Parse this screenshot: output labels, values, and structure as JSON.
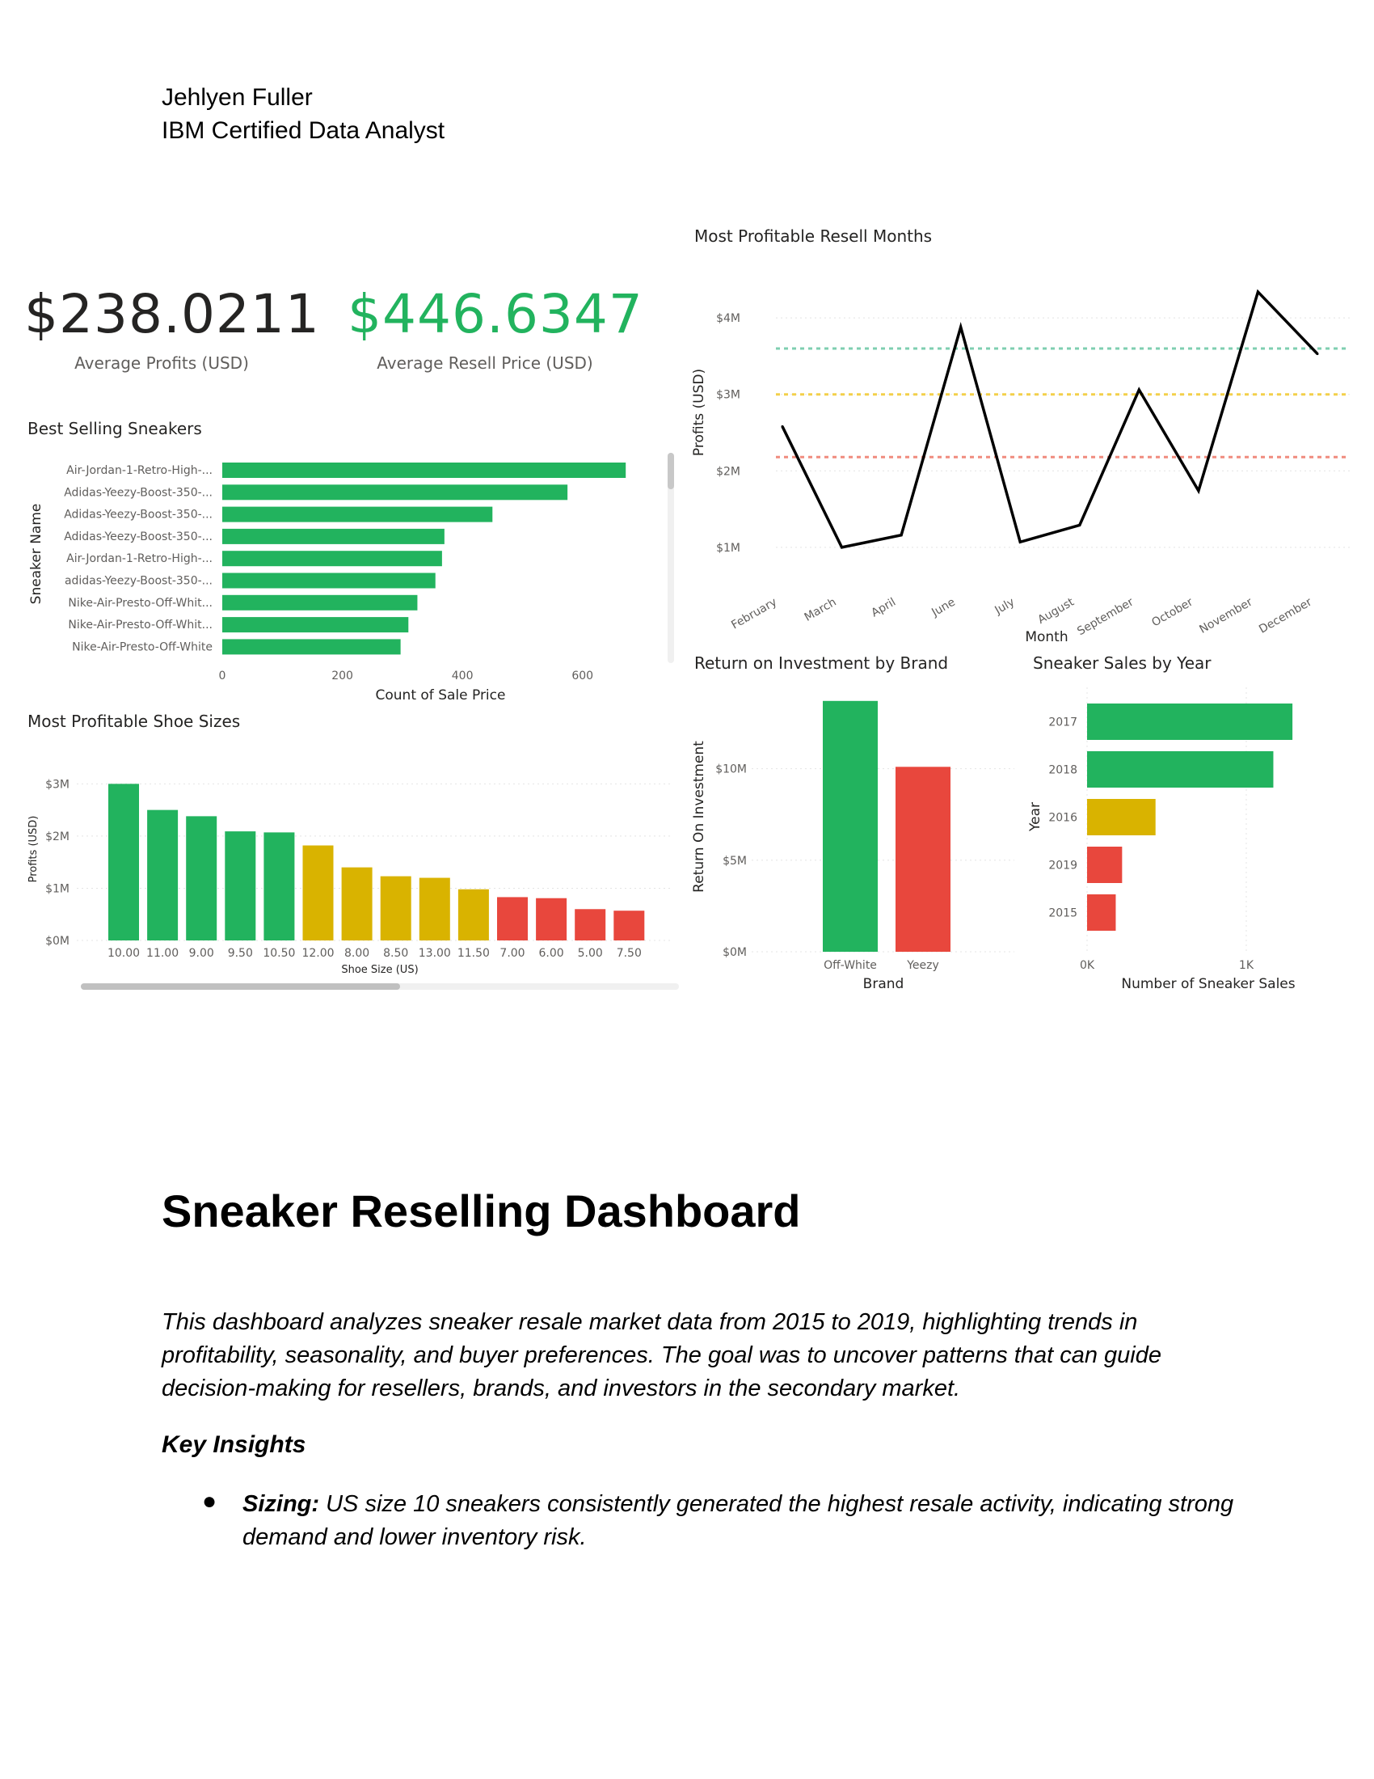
{
  "author": {
    "name": "Jehlyen Fuller",
    "role": "IBM Certified Data Analyst"
  },
  "kpis": {
    "avg_profit": {
      "value": "$238.0211",
      "label": "Average Profits (USD)",
      "color": "#252423"
    },
    "avg_resell": {
      "value": "$446.6347",
      "label": "Average Resell Price (USD)",
      "color": "#22b35e"
    }
  },
  "colors": {
    "green": "#22b35e",
    "yellow": "#d9b300",
    "red": "#e8473d",
    "line": "#000000"
  },
  "chart_data": [
    {
      "id": "best_selling",
      "type": "bar",
      "orientation": "horizontal",
      "title": "Best Selling Sneakers",
      "xlabel": "Count of Sale Price",
      "ylabel": "Sneaker Name",
      "xlim": [
        0,
        700
      ],
      "xticks": [
        "0",
        "200",
        "400",
        "600"
      ],
      "categories": [
        "Air-Jordan-1-Retro-High-...",
        "Adidas-Yeezy-Boost-350-...",
        "Adidas-Yeezy-Boost-350-...",
        "Adidas-Yeezy-Boost-350-...",
        "Air-Jordan-1-Retro-High-...",
        "adidas-Yeezy-Boost-350-...",
        "Nike-Air-Presto-Off-Whit...",
        "Nike-Air-Presto-Off-Whit...",
        "Nike-Air-Presto-Off-White"
      ],
      "values": [
        672,
        575,
        450,
        370,
        366,
        355,
        325,
        310,
        297
      ]
    },
    {
      "id": "profitable_months",
      "type": "line",
      "title": "Most Profitable Resell Months",
      "xlabel": "Month",
      "ylabel": "Profits (USD)",
      "ylim": [
        0.65,
        4.35
      ],
      "yticks": [
        "$1M",
        "$2M",
        "$3M",
        "$4M"
      ],
      "categories": [
        "February",
        "March",
        "April",
        "June",
        "July",
        "August",
        "September",
        "October",
        "November",
        "December"
      ],
      "values": [
        2.58,
        1.0,
        1.16,
        3.88,
        1.07,
        1.29,
        3.06,
        1.74,
        4.34,
        3.53
      ],
      "reference_lines": [
        {
          "value": 3.6,
          "color": "#7fcfb0"
        },
        {
          "value": 3.0,
          "color": "#f3d04a"
        },
        {
          "value": 2.18,
          "color": "#f08c7e"
        }
      ]
    },
    {
      "id": "shoe_sizes",
      "type": "bar",
      "title": "Most Profitable Shoe Sizes",
      "xlabel": "Shoe Size (US)",
      "ylabel": "Profits (USD)",
      "ylim": [
        0,
        3.3
      ],
      "yticks": [
        "$0M",
        "$1M",
        "$2M",
        "$3M"
      ],
      "categories": [
        "10.00",
        "11.00",
        "9.00",
        "9.50",
        "10.50",
        "12.00",
        "8.00",
        "8.50",
        "13.00",
        "11.50",
        "7.00",
        "6.00",
        "5.00",
        "7.50"
      ],
      "values": [
        3.0,
        2.5,
        2.38,
        2.09,
        2.07,
        1.82,
        1.4,
        1.23,
        1.2,
        0.98,
        0.83,
        0.81,
        0.6,
        0.57
      ],
      "bar_colors": [
        "green",
        "green",
        "green",
        "green",
        "green",
        "yellow",
        "yellow",
        "yellow",
        "yellow",
        "yellow",
        "red",
        "red",
        "red",
        "red"
      ]
    },
    {
      "id": "roi_brand",
      "type": "bar",
      "title": "Return on Investment by Brand",
      "xlabel": "Brand",
      "ylabel": "Return On Investment",
      "ylim": [
        0,
        14
      ],
      "yticks": [
        "$0M",
        "$5M",
        "$10M"
      ],
      "categories": [
        "Off-White",
        "Yeezy"
      ],
      "values": [
        13.7,
        10.1
      ],
      "bar_colors": [
        "green",
        "red"
      ]
    },
    {
      "id": "sales_by_year",
      "type": "bar",
      "orientation": "horizontal",
      "title": "Sneaker Sales by Year",
      "xlabel": "Number of Sneaker Sales",
      "ylabel": "Year",
      "xlim": [
        0,
        1650
      ],
      "xticks": [
        "0K",
        "1K"
      ],
      "categories": [
        "2017",
        "2018",
        "2016",
        "2019",
        "2015"
      ],
      "values": [
        1290,
        1170,
        430,
        220,
        180
      ],
      "bar_colors": [
        "green",
        "green",
        "yellow",
        "red",
        "red"
      ]
    }
  ],
  "doc": {
    "title": "Sneaker Reselling Dashboard",
    "intro": "This dashboard analyzes sneaker resale market data from 2015 to 2019, highlighting trends in profitability, seasonality, and buyer preferences. The goal was to uncover patterns that can guide decision-making for resellers, brands, and investors in the secondary market.",
    "key_insights_heading": "Key Insights",
    "bullet_symbol": "●",
    "bullets": [
      {
        "label": "Sizing:",
        "text": " US size 10 sneakers consistently generated the highest resale activity, indicating strong demand and lower inventory risk."
      }
    ]
  }
}
